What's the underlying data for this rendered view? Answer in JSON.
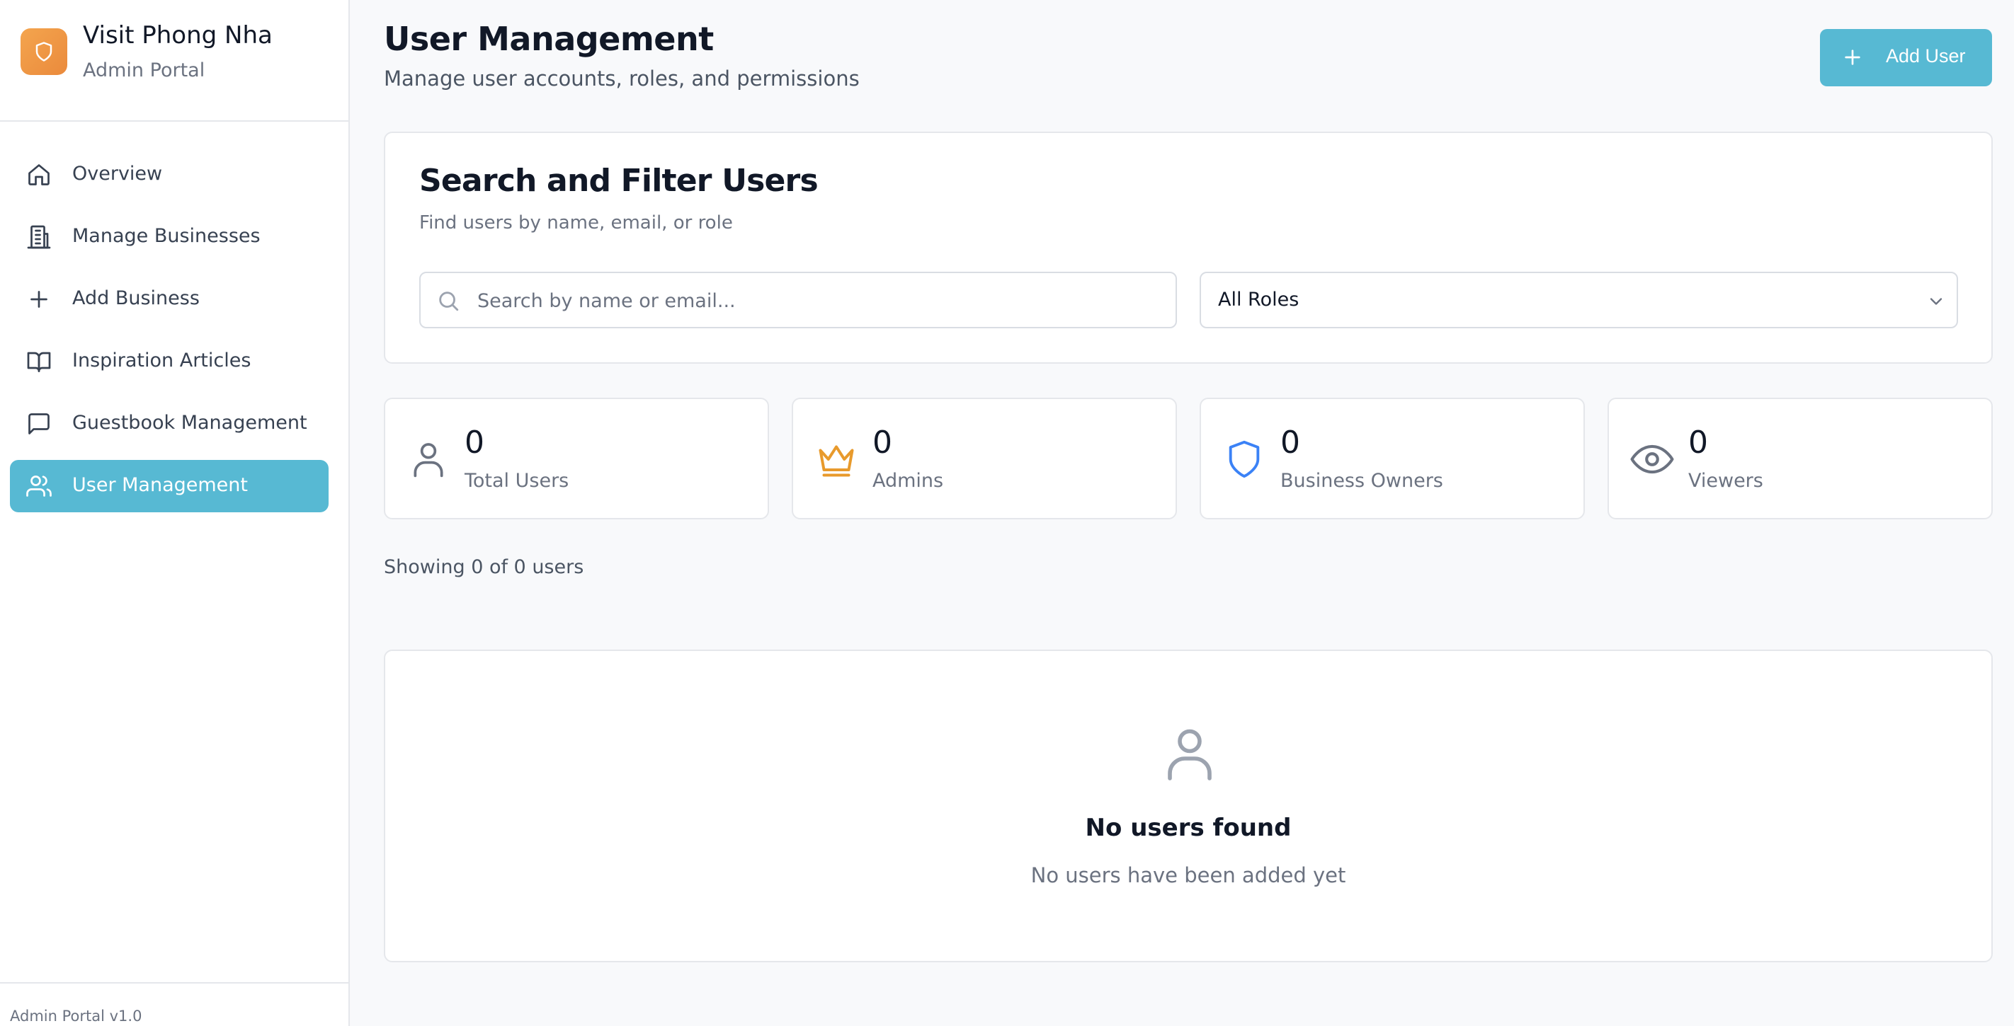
{
  "brand": {
    "title": "Visit Phong Nha",
    "subtitle": "Admin Portal"
  },
  "sidebar": {
    "items": [
      {
        "label": "Overview",
        "icon": "home-icon",
        "active": false
      },
      {
        "label": "Manage Businesses",
        "icon": "building-icon",
        "active": false
      },
      {
        "label": "Add Business",
        "icon": "plus-icon",
        "active": false
      },
      {
        "label": "Inspiration Articles",
        "icon": "book-open-icon",
        "active": false
      },
      {
        "label": "Guestbook Management",
        "icon": "message-square-icon",
        "active": false
      },
      {
        "label": "User Management",
        "icon": "users-icon",
        "active": true
      }
    ],
    "footer": "Admin Portal v1.0"
  },
  "header": {
    "title": "User Management",
    "subtitle": "Manage user accounts, roles, and permissions",
    "add_user_label": "Add User"
  },
  "filter": {
    "title": "Search and Filter Users",
    "subtitle": "Find users by name, email, or role",
    "search_placeholder": "Search by name or email...",
    "search_value": "",
    "role_selected": "All Roles"
  },
  "stats": [
    {
      "value": "0",
      "label": "Total Users",
      "icon": "user-icon",
      "color": "#6b7280"
    },
    {
      "value": "0",
      "label": "Admins",
      "icon": "crown-icon",
      "color": "#e89a2c"
    },
    {
      "value": "0",
      "label": "Business Owners",
      "icon": "shield-icon",
      "color": "#3b82f6"
    },
    {
      "value": "0",
      "label": "Viewers",
      "icon": "eye-icon",
      "color": "#6b7280"
    }
  ],
  "showing_text": "Showing 0 of 0 users",
  "empty_state": {
    "title": "No users found",
    "subtitle": "No users have been added yet"
  },
  "colors": {
    "accent": "#57b9d3",
    "brand_gradient_start": "#f4a54e",
    "brand_gradient_end": "#ea8a3c"
  }
}
